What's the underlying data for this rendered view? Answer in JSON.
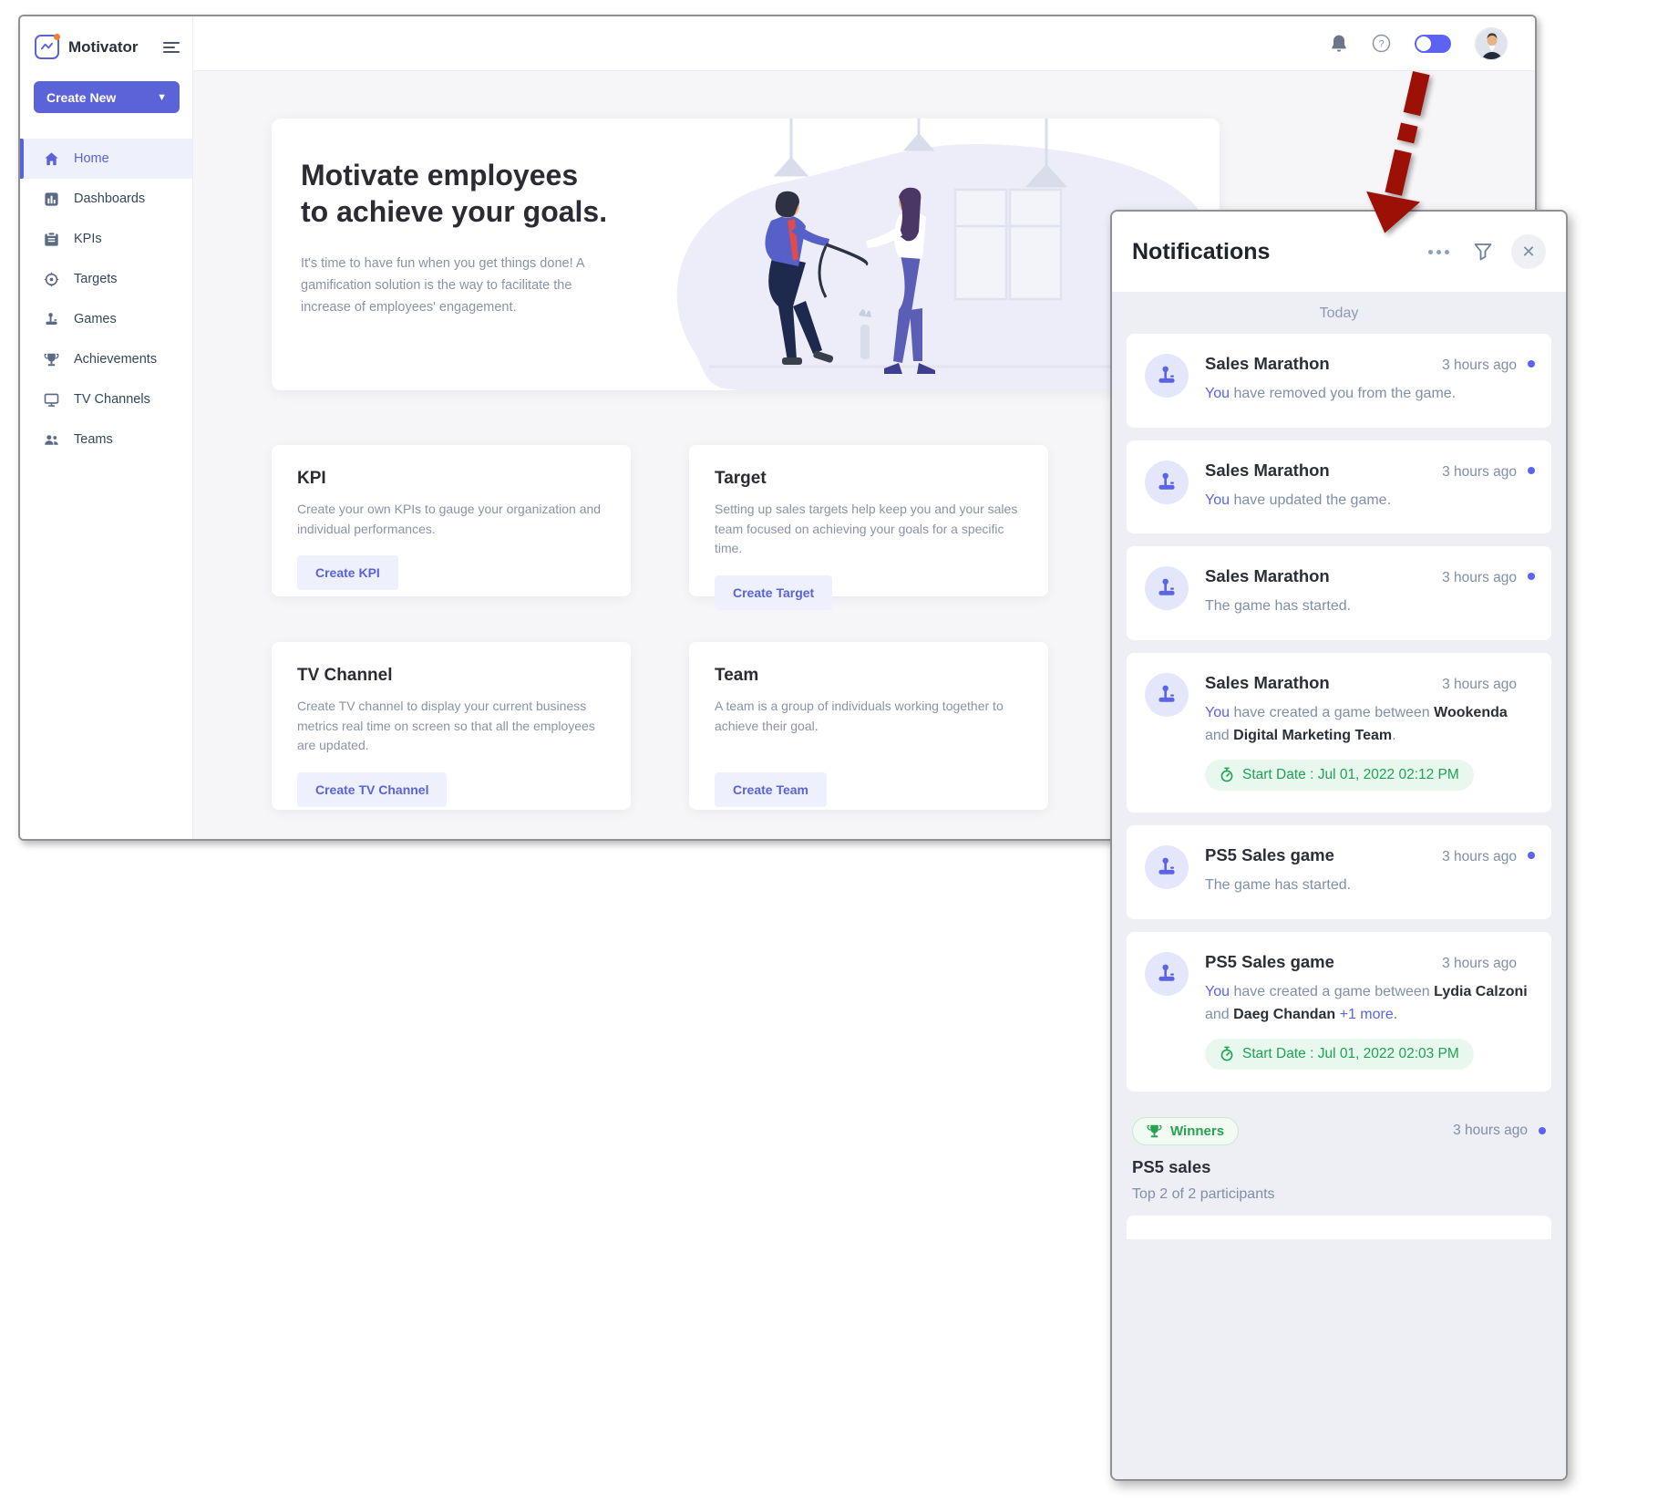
{
  "app": {
    "name": "Motivator"
  },
  "colors": {
    "accent": "#5b63d8",
    "green": "#1ea254",
    "arrow_red": "#9c1006",
    "unread_dot": "#5b63f1",
    "orange_logo_dot": "#f0812c"
  },
  "sidebar": {
    "create_new_label": "Create New",
    "items": [
      {
        "label": "Home"
      },
      {
        "label": "Dashboards"
      },
      {
        "label": "KPIs"
      },
      {
        "label": "Targets"
      },
      {
        "label": "Games"
      },
      {
        "label": "Achievements"
      },
      {
        "label": "TV Channels"
      },
      {
        "label": "Teams"
      }
    ]
  },
  "hero": {
    "title_line1": "Motivate employees",
    "title_line2": "to achieve your goals.",
    "description": "It's time to have fun when you get things done! A gamification solution is the way to facilitate the increase of employees' engagement."
  },
  "feature_cards": [
    {
      "title": "KPI",
      "description": "Create your own KPIs to gauge your organization and individual performances.",
      "button": "Create KPI"
    },
    {
      "title": "Target",
      "description": "Setting up sales targets help keep you and your sales team focused on achieving your goals for a specific time.",
      "button": "Create Target"
    },
    {
      "title": "TV Channel",
      "description": "Create TV channel to display your current business metrics real time on screen so that all the employees are updated.",
      "button": "Create TV Channel"
    },
    {
      "title": "Team",
      "description": "A team is a group of individuals working together to achieve their goal.",
      "button": "Create Team"
    }
  ],
  "notifications": {
    "title": "Notifications",
    "section_label": "Today",
    "items": [
      {
        "title": "Sales Marathon",
        "time": "3 hours ago",
        "unread": true,
        "segments": [
          {
            "t": "You"
          },
          {
            "t": " have removed you from the game."
          }
        ]
      },
      {
        "title": "Sales Marathon",
        "time": "3 hours ago",
        "unread": true,
        "segments": [
          {
            "t": "You"
          },
          {
            "t": " have updated the game."
          }
        ]
      },
      {
        "title": "Sales Marathon",
        "time": "3 hours ago",
        "unread": true,
        "segments": [
          {
            "t": "The game has started."
          }
        ]
      },
      {
        "title": "Sales Marathon",
        "time": "3 hours ago",
        "unread": false,
        "segments": [
          {
            "t": "You"
          },
          {
            "t": " have created a game between "
          },
          {
            "t": "Wookenda"
          },
          {
            "t": " and "
          },
          {
            "t": "Digital Marketing Team"
          },
          {
            "t": "."
          }
        ],
        "badge": "Start Date : Jul 01, 2022 02:12 PM"
      },
      {
        "title": "PS5 Sales game",
        "time": "3 hours ago",
        "unread": true,
        "segments": [
          {
            "t": "The game has started."
          }
        ]
      },
      {
        "title": "PS5 Sales game",
        "time": "3 hours ago",
        "unread": false,
        "segments": [
          {
            "t": "You"
          },
          {
            "t": " have created a game between "
          },
          {
            "t": "Lydia Calzoni"
          },
          {
            "t": " and "
          },
          {
            "t": "Daeg Chandan"
          },
          {
            "t": " "
          },
          {
            "t": "+1 more."
          }
        ],
        "badge": "Start Date : Jul 01, 2022 02:03 PM"
      },
      {
        "title": "PS5 sales",
        "time": "3 hours ago",
        "unread": true,
        "pill": "Winners",
        "subtitle": "Top 2 of 2 participants"
      }
    ]
  }
}
